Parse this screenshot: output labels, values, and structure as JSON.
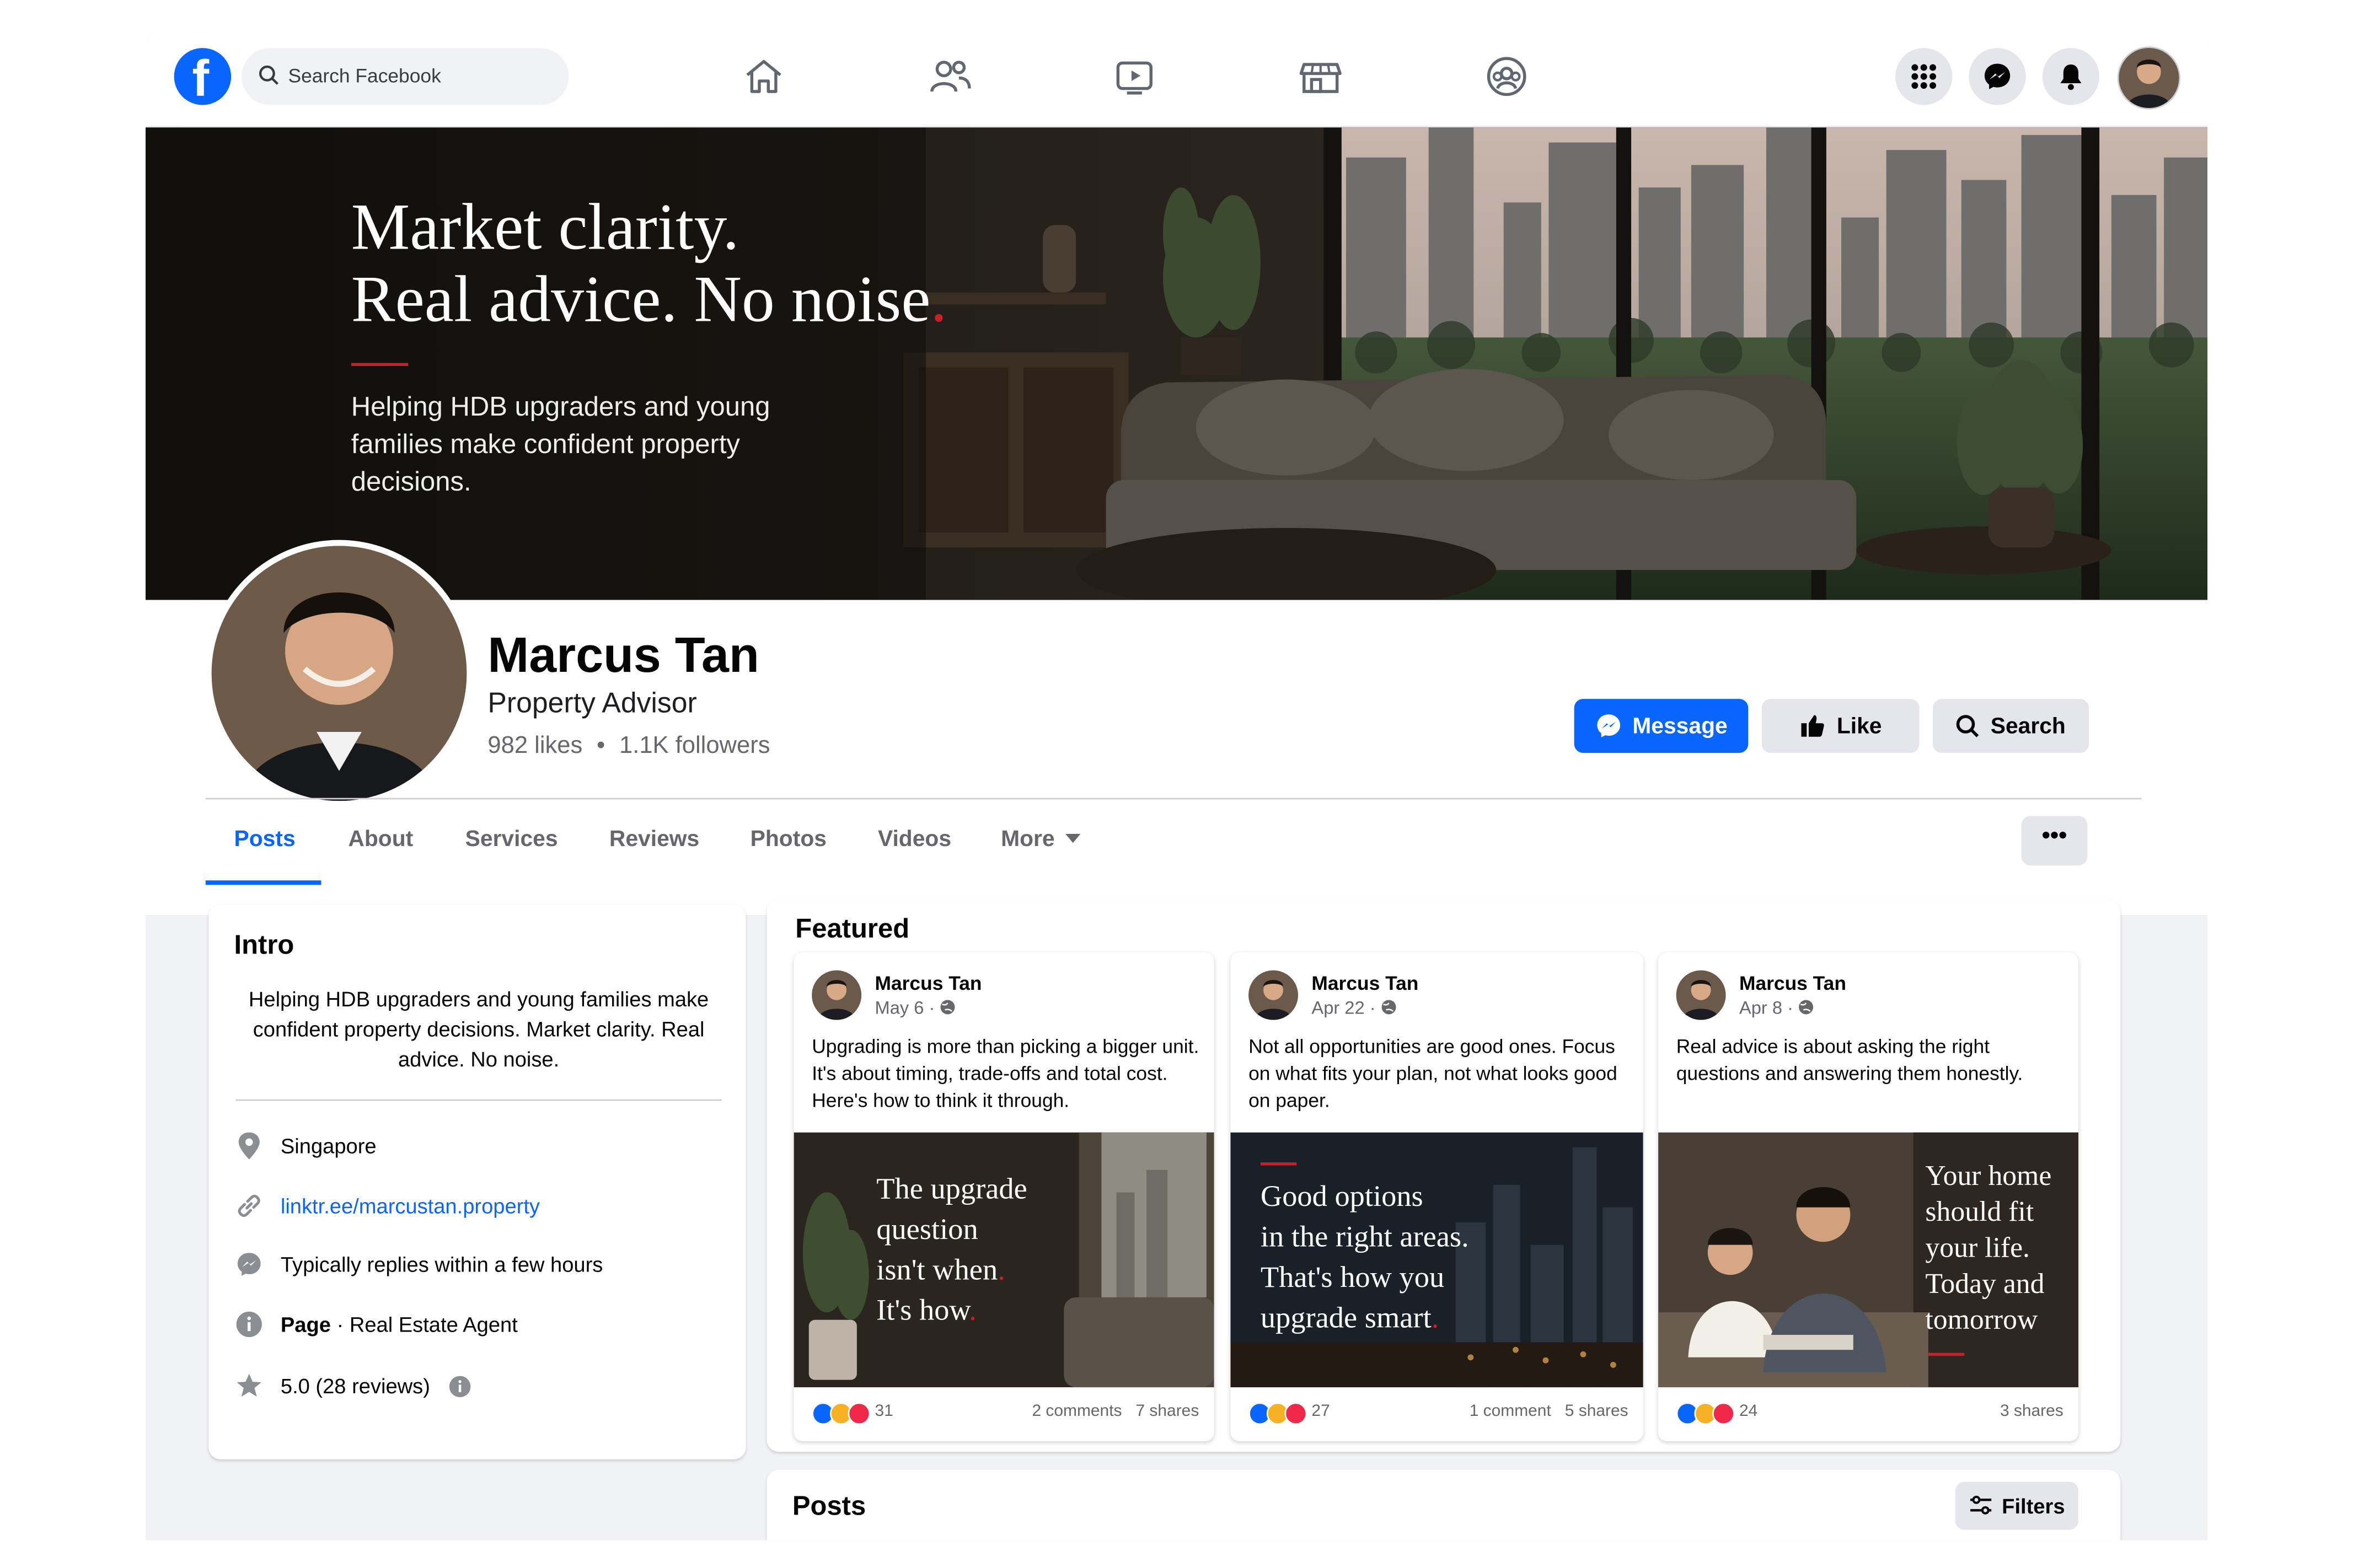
{
  "topbar": {
    "search_placeholder": "Search Facebook",
    "nav_icons": [
      "home-icon",
      "friends-icon",
      "watch-icon",
      "marketplace-icon",
      "groups-icon"
    ],
    "right_icons": [
      "menu-grid-icon",
      "messenger-icon",
      "notifications-icon"
    ]
  },
  "cover": {
    "headline_line1": "Market clarity.",
    "headline_line2": "Real advice. No noise",
    "headline_dot": ".",
    "subtext": "Helping HDB upgraders and young families make confident property decisions."
  },
  "profile": {
    "name": "Marcus Tan",
    "role": "Property Advisor",
    "likes": "982 likes",
    "separator": "•",
    "followers": "1.1K followers",
    "buttons": {
      "message": "Message",
      "like": "Like",
      "search": "Search"
    }
  },
  "tabs": [
    {
      "label": "Posts"
    },
    {
      "label": "About"
    },
    {
      "label": "Services"
    },
    {
      "label": "Reviews"
    },
    {
      "label": "Photos"
    },
    {
      "label": "Videos"
    },
    {
      "label": "More"
    }
  ],
  "more_menu": "•••",
  "intro": {
    "title": "Intro",
    "bio": "Helping HDB upgraders and young families make confident property decisions. Market clarity. Real advice. No noise.",
    "location": "Singapore",
    "link": "linktr.ee/marcustan.property",
    "response": "Typically replies within a few hours",
    "page_type_bold": "Page",
    "page_type_rest": " · Real Estate Agent",
    "rating": "5.0 (28 reviews)"
  },
  "featured": {
    "title": "Featured",
    "posts": [
      {
        "author": "Marcus Tan",
        "date": "May 6 · ",
        "text": "Upgrading is more than picking a bigger unit. It's about timing, trade-offs and total cost. Here's how to think it through.",
        "image_caption": [
          "The upgrade",
          "question",
          "isn't when",
          "It's how"
        ],
        "reactions": "31",
        "comments": "2 comments",
        "shares": "7 shares"
      },
      {
        "author": "Marcus Tan",
        "date": "Apr 22 · ",
        "text": "Not all opportunities are good ones. Focus on what fits your plan, not what looks good on paper.",
        "image_caption": [
          "Good options",
          "in the right areas.",
          "That's how you",
          "upgrade smart"
        ],
        "reactions": "27",
        "comments": "1 comment",
        "shares": "5 shares"
      },
      {
        "author": "Marcus Tan",
        "date": "Apr 8 · ",
        "text": "Real advice is about asking the right questions and answering them honestly.",
        "image_caption": [
          "Your home",
          "should fit",
          "your life.",
          "Today and",
          "tomorrow"
        ],
        "reactions": "24",
        "comments": "",
        "shares": "3 shares"
      }
    ]
  },
  "posts_section": {
    "title": "Posts",
    "filters": "Filters"
  },
  "colors": {
    "brand_blue": "#0866ff",
    "accent_red": "#c8202a",
    "page_bg": "#f0f2f5"
  }
}
